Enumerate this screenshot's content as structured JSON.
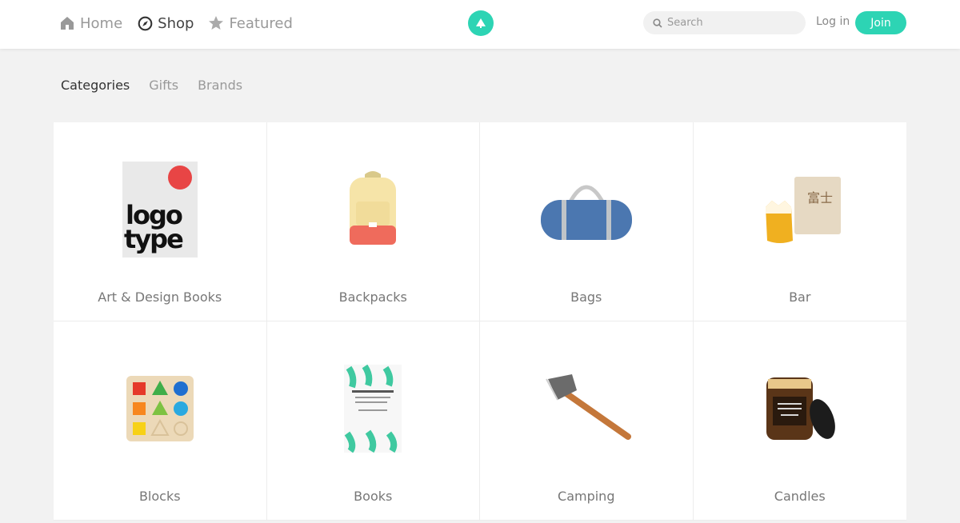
{
  "header": {
    "nav": [
      {
        "label": "Home",
        "icon": "home-icon"
      },
      {
        "label": "Shop",
        "icon": "compass-icon",
        "active": true
      },
      {
        "label": "Featured",
        "icon": "star-icon"
      }
    ],
    "search_placeholder": "Search",
    "login_label": "Log in",
    "join_label": "Join",
    "accent_color": "#2dd4b4"
  },
  "subnav": {
    "tabs": [
      {
        "label": "Categories",
        "active": true
      },
      {
        "label": "Gifts"
      },
      {
        "label": "Brands"
      }
    ]
  },
  "categories": [
    {
      "label": "Art & Design Books",
      "image": "logo-type-book"
    },
    {
      "label": "Backpacks",
      "image": "backpack"
    },
    {
      "label": "Bags",
      "image": "duffel-bag"
    },
    {
      "label": "Bar",
      "image": "beer-glass-box"
    },
    {
      "label": "Blocks",
      "image": "shape-sorter-blocks"
    },
    {
      "label": "Books",
      "image": "creative-book"
    },
    {
      "label": "Camping",
      "image": "axe"
    },
    {
      "label": "Candles",
      "image": "candle-jar"
    }
  ]
}
